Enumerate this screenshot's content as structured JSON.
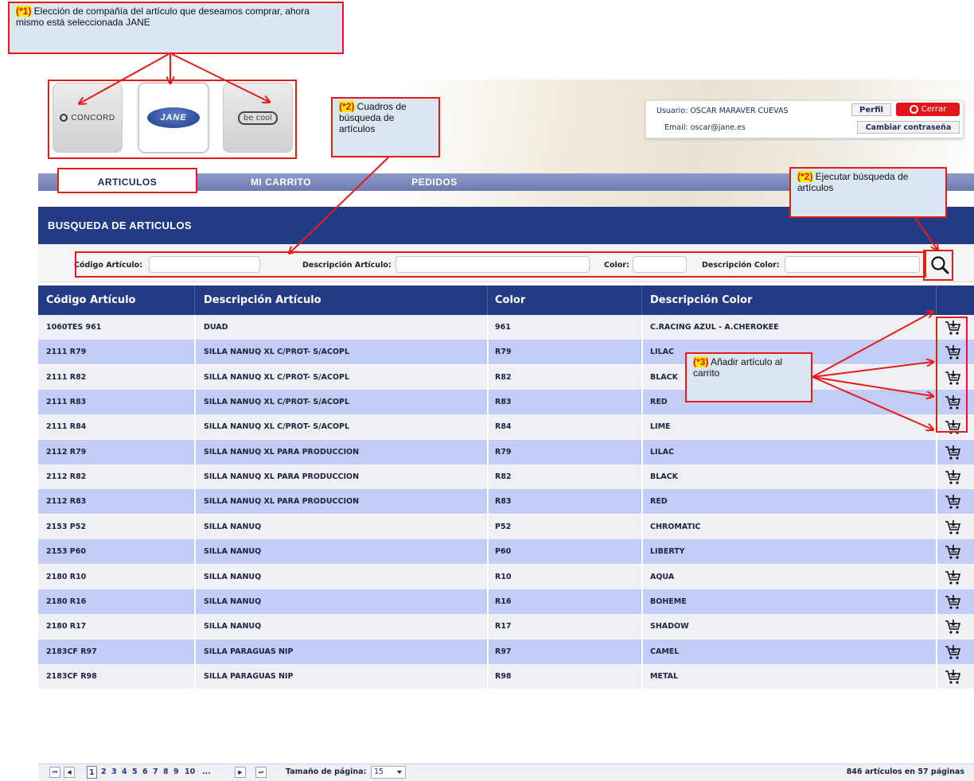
{
  "annotations": {
    "a1_tag": "(*1)",
    "a1_text": " Elección de compañía del artículo que deseamos comprar, ahora mismo está seleccionada JANE",
    "a2_tag": "(*2)",
    "a2_text": " Cuadros de búsqueda de artículos",
    "a2b_tag": "(*2)",
    "a2b_text": " Ejecutar búsqueda de artículos",
    "a3_tag": "(*3)",
    "a3_text": " Añadir artículo al carrito"
  },
  "brands": [
    {
      "label": "CONCORD",
      "icon": "concord-logo"
    },
    {
      "label": "JANE",
      "icon": "jane-logo"
    },
    {
      "label": "be cool",
      "icon": "becool-logo"
    }
  ],
  "user": {
    "usuario": "Usuario: OSCAR MARAVER CUEVAS",
    "email": "Email: oscar@jane.es",
    "perfil": "Perfil",
    "cerrar": "Cerrar",
    "cambiar": "Cambiar contraseña"
  },
  "nav": [
    "ARTICULOS",
    "MI CARRITO",
    "PEDIDOS"
  ],
  "search": {
    "title": "BUSQUEDA DE ARTICULOS",
    "codigo_label": "Código Artículo:",
    "descripcion_label": "Descripción Artículo:",
    "color_label": "Color:",
    "desc_color_label": "Descripción Color:",
    "codigo_value": "",
    "descripcion_value": "",
    "color_value": "",
    "desc_color_value": ""
  },
  "table": {
    "headers": [
      "Código Artículo",
      "Descripción Artículo",
      "Color",
      "Descripción Color"
    ],
    "rows": [
      [
        "1060TES 961",
        "DUAD",
        "961",
        "C.RACING AZUL - A.CHEROKEE"
      ],
      [
        "2111 R79",
        "SILLA NANUQ XL C/PROT- S/ACOPL",
        "R79",
        "LILAC"
      ],
      [
        "2111 R82",
        "SILLA NANUQ XL C/PROT- S/ACOPL",
        "R82",
        "BLACK"
      ],
      [
        "2111 R83",
        "SILLA NANUQ XL C/PROT- S/ACOPL",
        "R83",
        "RED"
      ],
      [
        "2111 R84",
        "SILLA NANUQ XL C/PROT- S/ACOPL",
        "R84",
        "LIME"
      ],
      [
        "2112 R79",
        "SILLA NANUQ XL PARA PRODUCCION",
        "R79",
        "LILAC"
      ],
      [
        "2112 R82",
        "SILLA NANUQ XL PARA PRODUCCION",
        "R82",
        "BLACK"
      ],
      [
        "2112 R83",
        "SILLA NANUQ XL PARA PRODUCCION",
        "R83",
        "RED"
      ],
      [
        "2153 P52",
        "SILLA NANUQ",
        "P52",
        "CHROMATIC"
      ],
      [
        "2153 P60",
        "SILLA NANUQ",
        "P60",
        "LIBERTY"
      ],
      [
        "2180 R10",
        "SILLA NANUQ",
        "R10",
        "AQUA"
      ],
      [
        "2180 R16",
        "SILLA NANUQ",
        "R16",
        "BOHEME"
      ],
      [
        "2180 R17",
        "SILLA NANUQ",
        "R17",
        "SHADOW"
      ],
      [
        "2183CF R97",
        "SILLA PARAGUAS NIP",
        "R97",
        "CAMEL"
      ],
      [
        "2183CF R98",
        "SILLA PARAGUAS NIP",
        "R98",
        "METAL"
      ]
    ]
  },
  "pager": {
    "pages": [
      "1",
      "2",
      "3",
      "4",
      "5",
      "6",
      "7",
      "8",
      "9",
      "10",
      "..."
    ],
    "current": "1",
    "size_label": "Tamaño de página:",
    "size_value": "15",
    "total": "846 artículos en 57 páginas"
  },
  "colors": {
    "primary": "#233a85",
    "row_alt": "#c2ccf5",
    "row": "#eff0f5",
    "annotation_red": "#e31b1b",
    "cerrar_red": "#e3151a"
  }
}
